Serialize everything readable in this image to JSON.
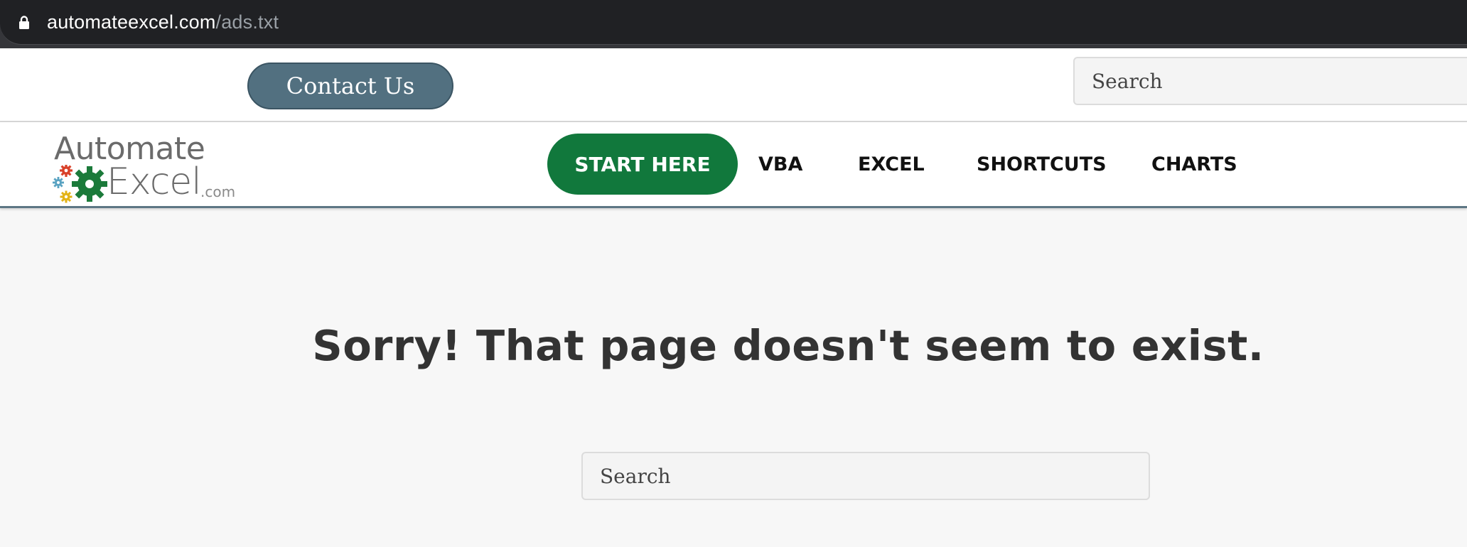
{
  "browser": {
    "url_host": "automateexcel.com",
    "url_path": "/ads.txt"
  },
  "topbar": {
    "contact_label": "Contact Us",
    "search_placeholder": "Search"
  },
  "logo": {
    "line1": "Automate",
    "line2": "Excel",
    "suffix": ".com"
  },
  "nav": {
    "start_label": "START HERE",
    "items": [
      {
        "label": "VBA"
      },
      {
        "label": "EXCEL"
      },
      {
        "label": "SHORTCUTS"
      },
      {
        "label": "CHARTS"
      }
    ]
  },
  "main": {
    "heading": "Sorry! That page doesn't seem to exist.",
    "search_placeholder": "Search"
  },
  "colors": {
    "start_button": "#11783c",
    "contact_button": "#527080",
    "heading": "#333333"
  }
}
